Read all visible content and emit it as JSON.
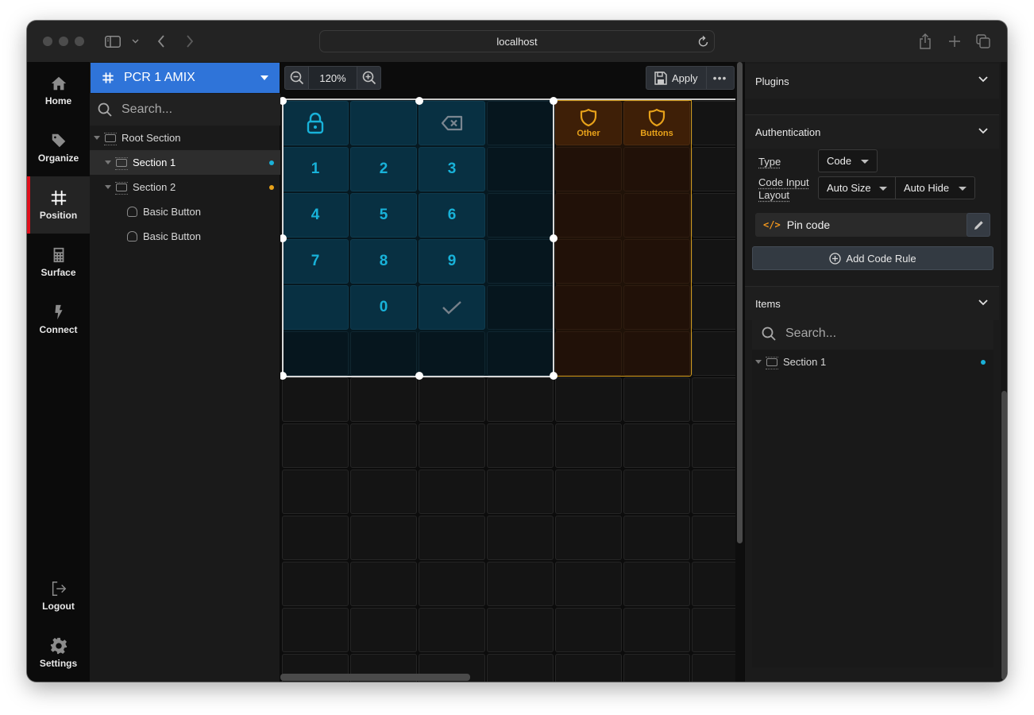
{
  "browser": {
    "url": "localhost",
    "traffic_lights": [
      "close",
      "minimize",
      "zoom"
    ]
  },
  "leftnav": {
    "items": [
      {
        "label": "Home",
        "icon": "home-icon",
        "active": false
      },
      {
        "label": "Organize",
        "icon": "tag-icon",
        "active": false
      },
      {
        "label": "Position",
        "icon": "grid-icon",
        "active": true
      },
      {
        "label": "Surface",
        "icon": "calculator-icon",
        "active": false
      },
      {
        "label": "Connect",
        "icon": "bolt-icon",
        "active": false
      }
    ],
    "bottom_items": [
      {
        "label": "Logout",
        "icon": "logout-icon"
      },
      {
        "label": "Settings",
        "icon": "gear-icon"
      }
    ],
    "active_color": "#e0101d"
  },
  "tree": {
    "project": "PCR 1 AMIX",
    "search_placeholder": "Search...",
    "rows": [
      {
        "label": "Root Section",
        "type": "section",
        "level": 0,
        "selected": false,
        "dot": null
      },
      {
        "label": "Section 1",
        "type": "section",
        "level": 1,
        "selected": true,
        "dot": "#1ab1d8"
      },
      {
        "label": "Section 2",
        "type": "section",
        "level": 1,
        "selected": false,
        "dot": "#e8a21a"
      },
      {
        "label": "Basic Button",
        "type": "button",
        "level": 2,
        "selected": false,
        "dot": null
      },
      {
        "label": "Basic Button",
        "type": "button",
        "level": 2,
        "selected": false,
        "dot": null
      }
    ]
  },
  "canvas": {
    "zoom": "120%",
    "apply_label": "Apply",
    "more_label": "•••",
    "keypad": {
      "rows": [
        [
          "lock-icon",
          "",
          "backspace-icon"
        ],
        [
          "1",
          "2",
          "3"
        ],
        [
          "4",
          "5",
          "6"
        ],
        [
          "7",
          "8",
          "9"
        ],
        [
          "",
          "0",
          "check-icon"
        ]
      ]
    },
    "section2_buttons": [
      {
        "label": "Other",
        "icon": "shield-icon"
      },
      {
        "label": "Buttons",
        "icon": "shield-icon"
      }
    ],
    "colors": {
      "section1": "#18b2d9",
      "section2": "#e8a21a"
    }
  },
  "rightpanel": {
    "plugins_title": "Plugins",
    "auth_title": "Authentication",
    "type_label": "Type",
    "type_value": "Code",
    "layout_label_line1": "Code Input",
    "layout_label_line2": "Layout",
    "layout_size": "Auto Size",
    "layout_hide": "Auto Hide",
    "pin_code": "Pin code",
    "add_rule": "Add Code Rule",
    "items_title": "Items",
    "items_search_placeholder": "Search...",
    "items": [
      {
        "label": "Section 1",
        "dot": "#1ab1d8"
      }
    ]
  }
}
